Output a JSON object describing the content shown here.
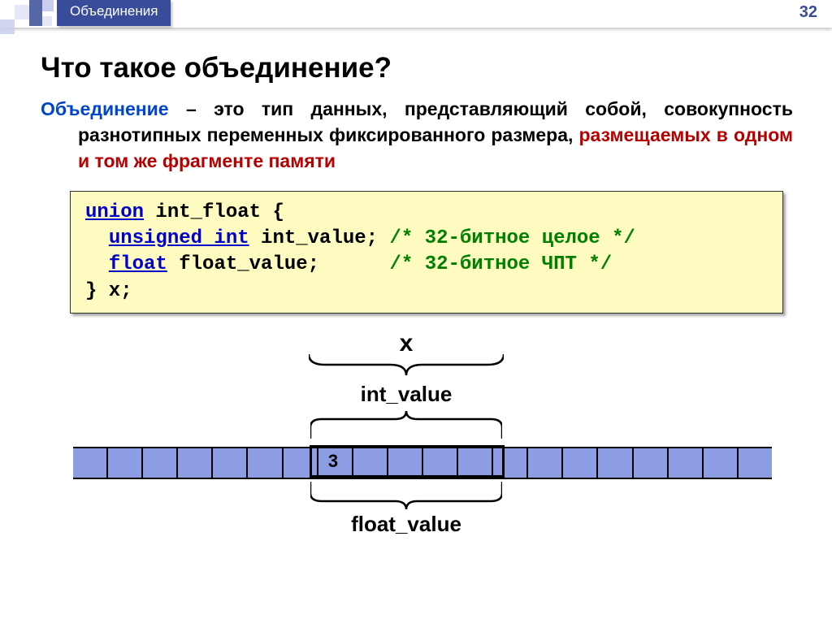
{
  "header": {
    "breadcrumb": "Объединения",
    "page_number": "32"
  },
  "title": "Что такое объединение?",
  "definition": {
    "term": "Объединение",
    "text_prefix": " – это тип данных, представляющий собой, совокупность разнотипных переменных фиксированного размера, ",
    "highlight": "размещаемых в одном и том же фрагменте памяти"
  },
  "code": {
    "l1_kw": "union",
    "l1_rest": " int_float {",
    "l2_kw": "unsigned int",
    "l2_rest": " int_value; ",
    "l2_cm": "/* 32-битное целое */",
    "l3_kw": "float",
    "l3_rest": " float_value;      ",
    "l3_cm": "/* 32-битное ЧПТ */",
    "l4": "} x;"
  },
  "diagram": {
    "label_x": "x",
    "label_int": "int_value",
    "label_float": "float_value",
    "cell_value": "3"
  }
}
